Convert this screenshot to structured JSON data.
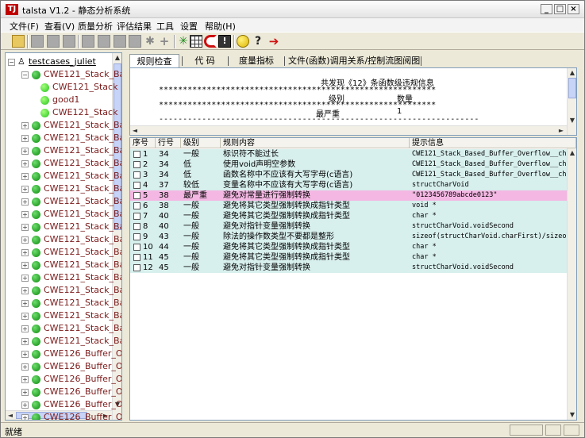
{
  "window": {
    "icon_glyph": "TJ",
    "title": "talsta V1.2 - 静态分析系统",
    "minimize_glyph": "_",
    "maximize_glyph": "□",
    "close_glyph": "×"
  },
  "menu": [
    "文件(F)",
    "查看(V)",
    "质量分析",
    "评估结果",
    "工具",
    "设置",
    "帮助(H)"
  ],
  "toolbar_icons": [
    "open-folder-icon",
    "save-icon",
    "export-icon",
    "edit-icon",
    "list-icon",
    "table-icon",
    "stack-icon",
    "copy-icon",
    "tools-icon",
    "add-icon",
    "graph-icon",
    "grid-icon",
    "magnet-icon",
    "info-icon",
    "circle-icon",
    "help-icon",
    "run-arrow-icon"
  ],
  "tree": {
    "root": "testcases_juliet",
    "items": [
      "CWE121_Stack_Ba",
      "CWE121_Stack",
      "good1",
      "CWE121_Stack",
      "CWE121_Stack_Ba",
      "CWE121_Stack_Ba",
      "CWE121_Stack_Ba",
      "CWE121_Stack_Ba",
      "CWE121_Stack_Ba",
      "CWE121_Stack_Ba",
      "CWE121_Stack_Ba",
      "CWE121_Stack_Ba",
      "CWE121_Stack_Ba",
      "CWE121_Stack_Ba",
      "CWE121_Stack_Ba",
      "CWE121_Stack_Ba",
      "CWE121_Stack_Ba",
      "CWE121_Stack_Ba",
      "CWE121_Stack_Ba",
      "CWE121_Stack_Ba",
      "CWE121_Stack_Ba",
      "CWE121_Stack_Ba",
      "CWE126_Buffer_O",
      "CWE126_Buffer_O",
      "CWE126_Buffer_O",
      "CWE126_Buffer_O",
      "CWE126_Buffer_O",
      "CWE126_Buffer_O"
    ]
  },
  "tabs": [
    "规则检查",
    "代  码",
    "度量指标",
    "文件(函数)调用关系/控制流图阅图"
  ],
  "summary": {
    "heading": "共发现《12》条函数级违规信息",
    "stars": "**********************************************************",
    "col_level": "级别",
    "col_count": "数量",
    "row_level": "最严重",
    "row_count": "1",
    "dashes": "--------------------------------------------------------------------------------"
  },
  "grid": {
    "columns": [
      "序号",
      "行号",
      "级别",
      "规则内容",
      "提示信息"
    ],
    "rows": [
      {
        "no": "1",
        "line": "34",
        "level": "一般",
        "rule": "标识符不能过长",
        "hint": "CWE121_Stack_Based_Buffer_Overflow__ch..."
      },
      {
        "no": "2",
        "line": "34",
        "level": "低",
        "rule": "使用void声明空参数",
        "hint": "CWE121_Stack_Based_Buffer_Overflow__ch..."
      },
      {
        "no": "3",
        "line": "34",
        "level": "低",
        "rule": "函数名称中不应该有大写字母(c语言)",
        "hint": "CWE121_Stack_Based_Buffer_Overflow__ch..."
      },
      {
        "no": "4",
        "line": "37",
        "level": "较低",
        "rule": "变量名称中不应该有大写字母(c语言)",
        "hint": "structCharVoid"
      },
      {
        "no": "5",
        "line": "38",
        "level": "最严重",
        "rule": "避免对常量进行强制转换",
        "hint": "\"0123456789abcde0123\""
      },
      {
        "no": "6",
        "line": "38",
        "level": "一般",
        "rule": "避免将其它类型强制转换成指针类型",
        "hint": "void *"
      },
      {
        "no": "7",
        "line": "40",
        "level": "一般",
        "rule": "避免将其它类型强制转换成指针类型",
        "hint": "char *"
      },
      {
        "no": "8",
        "line": "40",
        "level": "一般",
        "rule": "避免对指针变量强制转换",
        "hint": "structCharVoid.voidSecond"
      },
      {
        "no": "9",
        "line": "43",
        "level": "一般",
        "rule": "除法的操作数类型不要都是整形",
        "hint": "sizeof(structCharVoid.charFirst)/sizeo..."
      },
      {
        "no": "10",
        "line": "44",
        "level": "一般",
        "rule": "避免将其它类型强制转换成指针类型",
        "hint": "char *"
      },
      {
        "no": "11",
        "line": "45",
        "level": "一般",
        "rule": "避免将其它类型强制转换成指针类型",
        "hint": "char *"
      },
      {
        "no": "12",
        "line": "45",
        "level": "一般",
        "rule": "避免对指针变量强制转换",
        "hint": "structCharVoid.voidSecond"
      }
    ]
  },
  "status": {
    "text": "就绪"
  },
  "colors": {
    "row": "#d7efed",
    "row_highlight": "#f4b7e3",
    "tree_text": "#7b1a1a",
    "node_green": "#0b8a0b"
  }
}
